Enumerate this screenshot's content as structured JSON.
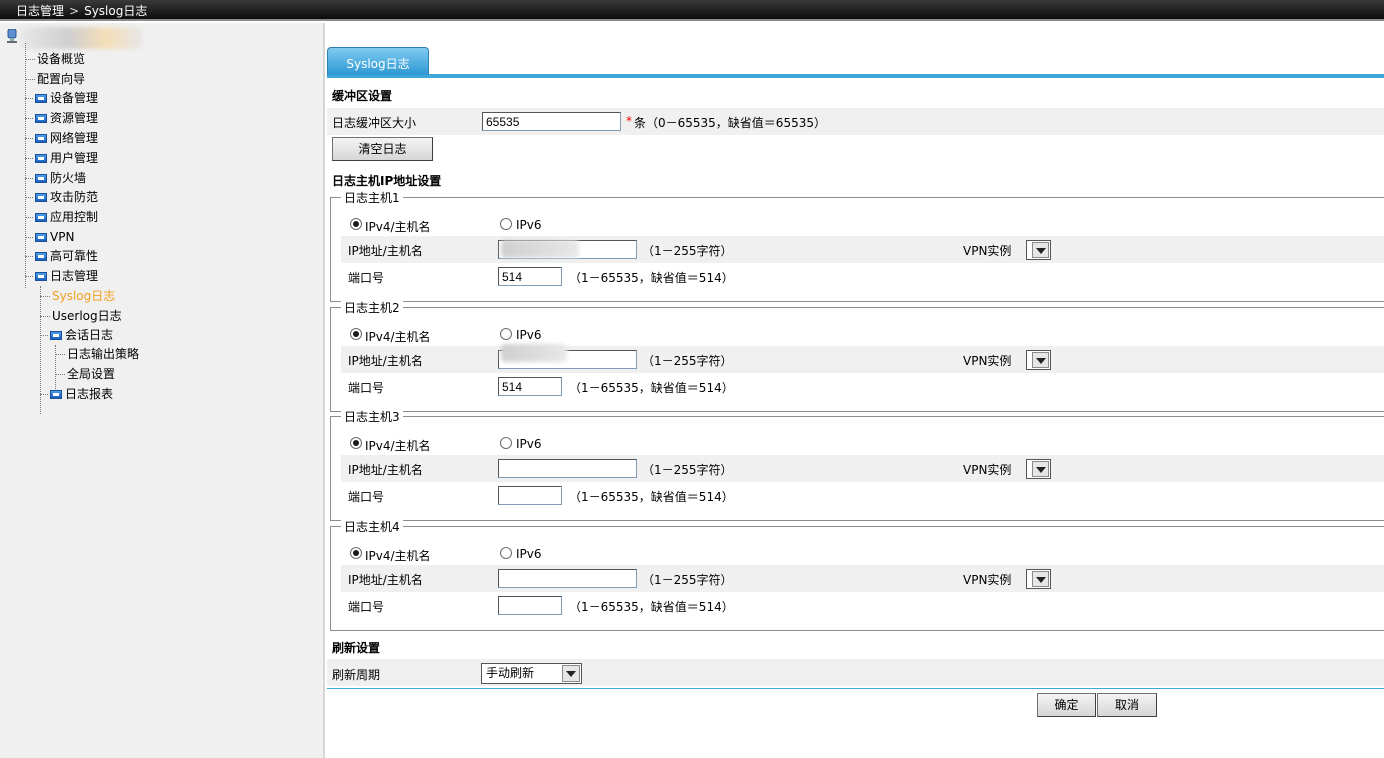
{
  "breadcrumb": {
    "parent": "日志管理",
    "separator": ">",
    "current": "Syslog日志"
  },
  "sidebar": {
    "items": [
      {
        "label": "设备概览"
      },
      {
        "label": "配置向导"
      },
      {
        "label": "设备管理"
      },
      {
        "label": "资源管理"
      },
      {
        "label": "网络管理"
      },
      {
        "label": "用户管理"
      },
      {
        "label": "防火墙"
      },
      {
        "label": "攻击防范"
      },
      {
        "label": "应用控制"
      },
      {
        "label": "VPN"
      },
      {
        "label": "高可靠性"
      },
      {
        "label": "日志管理"
      },
      {
        "label": "Syslog日志"
      },
      {
        "label": "Userlog日志"
      },
      {
        "label": "会话日志"
      },
      {
        "label": "日志输出策略"
      },
      {
        "label": "全局设置"
      },
      {
        "label": "日志报表"
      }
    ]
  },
  "tab": {
    "label": "Syslog日志"
  },
  "buffer": {
    "section_title": "缓冲区设置",
    "size_label": "日志缓冲区大小",
    "size_value": "65535",
    "required_mark": "*",
    "size_hint": "条（0－65535，缺省值＝65535）",
    "clear_button": "清空日志"
  },
  "hosts_section_title": "日志主机IP地址设置",
  "hosts": [
    {
      "legend": "日志主机1",
      "ipv4_label": "IPv4/主机名",
      "ipv6_label": "IPv6",
      "ip_label": "IP地址/主机名",
      "ip_hint": "（1－255字符）",
      "vpn_label": "VPN实例",
      "port_label": "端口号",
      "port_value": "514",
      "port_hint": "（1－65535，缺省值＝514）"
    },
    {
      "legend": "日志主机2",
      "ipv4_label": "IPv4/主机名",
      "ipv6_label": "IPv6",
      "ip_label": "IP地址/主机名",
      "ip_hint": "（1－255字符）",
      "vpn_label": "VPN实例",
      "port_label": "端口号",
      "port_value": "514",
      "port_hint": "（1－65535，缺省值＝514）"
    },
    {
      "legend": "日志主机3",
      "ipv4_label": "IPv4/主机名",
      "ipv6_label": "IPv6",
      "ip_label": "IP地址/主机名",
      "ip_hint": "（1－255字符）",
      "vpn_label": "VPN实例",
      "port_label": "端口号",
      "port_value": "",
      "port_hint": "（1－65535，缺省值＝514）"
    },
    {
      "legend": "日志主机4",
      "ipv4_label": "IPv4/主机名",
      "ipv6_label": "IPv6",
      "ip_label": "IP地址/主机名",
      "ip_hint": "（1－255字符）",
      "vpn_label": "VPN实例",
      "port_label": "端口号",
      "port_value": "",
      "port_hint": "（1－65535，缺省值＝514）"
    }
  ],
  "refresh": {
    "section_title": "刷新设置",
    "period_label": "刷新周期",
    "period_value": "手动刷新"
  },
  "actions": {
    "ok": "确定",
    "cancel": "取消"
  },
  "colors": {
    "accent": "#3ea6d8",
    "active_tree": "#f0a020",
    "required": "#ee0000"
  }
}
